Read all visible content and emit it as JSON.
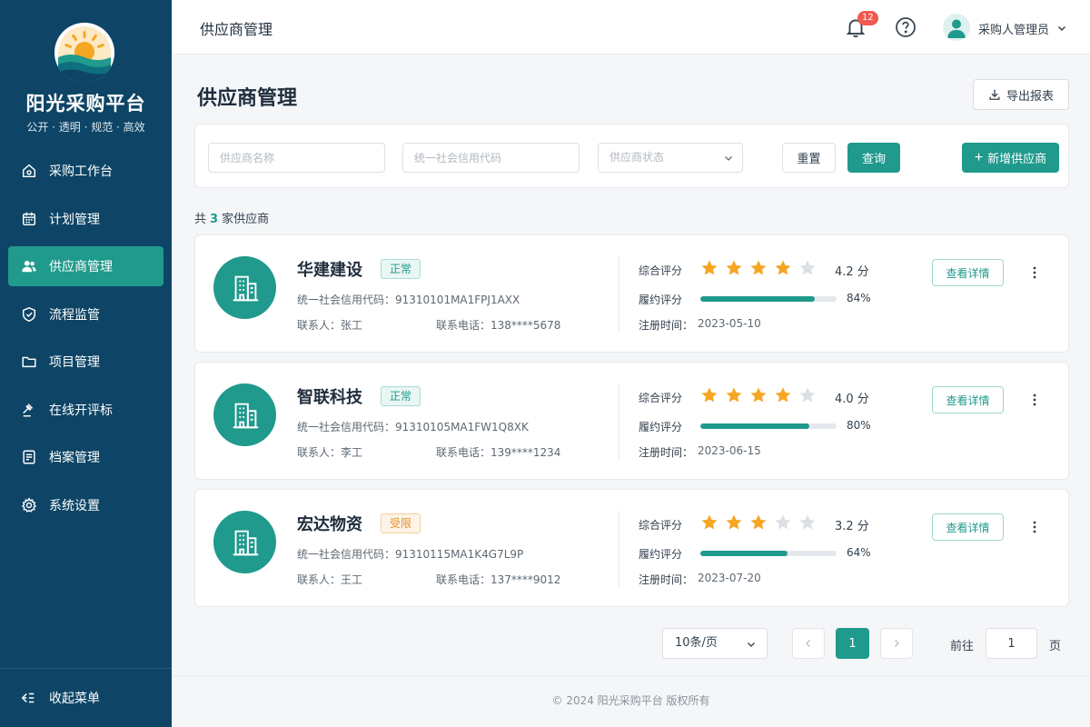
{
  "brand": {
    "title": "阳光采购平台",
    "subtitle": "公开 · 透明 · 规范 · 高效",
    "logo_icon": "sun-over-waves-logo"
  },
  "sidebar": {
    "items": [
      {
        "label": "采购工作台",
        "icon": "workbench-icon",
        "active": false
      },
      {
        "label": "计划管理",
        "icon": "calendar-icon",
        "active": false
      },
      {
        "label": "供应商管理",
        "icon": "users-icon",
        "active": true
      },
      {
        "label": "流程监管",
        "icon": "shield-icon",
        "active": false
      },
      {
        "label": "项目管理",
        "icon": "folder-icon",
        "active": false
      },
      {
        "label": "在线开评标",
        "icon": "gavel-icon",
        "active": false
      },
      {
        "label": "档案管理",
        "icon": "archive-icon",
        "active": false
      },
      {
        "label": "系统设置",
        "icon": "gear-icon",
        "active": false
      }
    ],
    "collapse_label": "收起菜单"
  },
  "topbar": {
    "title": "供应商管理",
    "notification_count": "12",
    "user_name": "采购人管理员"
  },
  "page": {
    "title": "供应商管理",
    "export_label": "导出报表"
  },
  "filters": {
    "name_placeholder": "供应商名称",
    "code_placeholder": "统一社会信用代码",
    "status_placeholder": "供应商状态",
    "reset_label": "重置",
    "query_label": "查询",
    "add_label": "新增供应商"
  },
  "summary": {
    "prefix": "共",
    "count": "3",
    "suffix": "家供应商"
  },
  "card_labels": {
    "rating": "综合评分",
    "performance": "履约评分",
    "registered": "注册时间：",
    "detail_button": "查看详情"
  },
  "colors": {
    "brand_dark": "#0e4566",
    "accent": "#1f9a8c",
    "star": "#f5a623",
    "star_empty": "#dcdfe4",
    "warning": "#e6932c"
  },
  "suppliers": [
    {
      "name": "华建建设",
      "status": "正常",
      "status_type": "ok",
      "code": "统一社会信用代码：91310101MA1FPJ1AXX",
      "contact": "联系人：张工",
      "phone": "联系电话：138****5678",
      "stars": 4,
      "score": "4.2 分",
      "performance": 84,
      "performance_text": "84%",
      "date": "2023-05-10"
    },
    {
      "name": "智联科技",
      "status": "正常",
      "status_type": "ok",
      "code": "统一社会信用代码：91310105MA1FW1Q8XK",
      "contact": "联系人：李工",
      "phone": "联系电话：139****1234",
      "stars": 4,
      "score": "4.0 分",
      "performance": 80,
      "performance_text": "80%",
      "date": "2023-06-15"
    },
    {
      "name": "宏达物资",
      "status": "受限",
      "status_type": "warn",
      "code": "统一社会信用代码：91310115MA1K4G7L9P",
      "contact": "联系人：王工",
      "phone": "联系电话：137****9012",
      "stars": 3,
      "score": "3.2 分",
      "performance": 64,
      "performance_text": "64%",
      "date": "2023-07-20"
    }
  ],
  "pagination": {
    "page_size": "10条/页",
    "current": "1",
    "goto_label": "前往",
    "goto_value": "1",
    "goto_unit": "页"
  },
  "footer": {
    "text": "© 2024 阳光采购平台 版权所有"
  }
}
